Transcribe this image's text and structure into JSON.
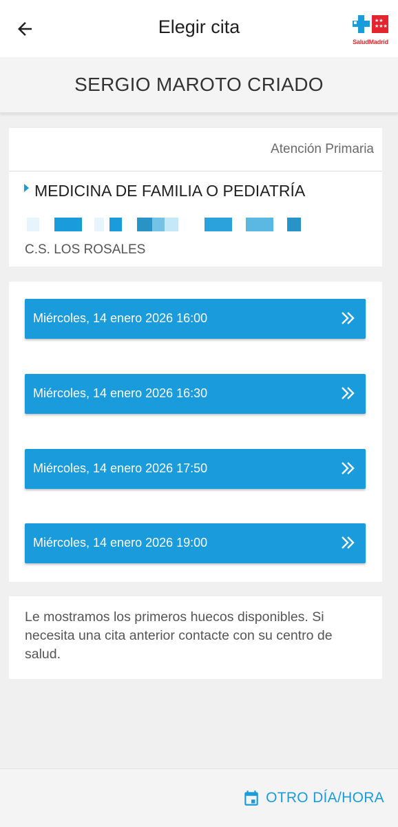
{
  "header": {
    "title": "Elegir cita",
    "back_icon": "arrow-back-icon",
    "logo_text": "SaludMadrid"
  },
  "patient": {
    "name": "SERGIO MAROTO CRIADO"
  },
  "info": {
    "care_level": "Atención Primaria",
    "specialty": "MEDICINA DE FAMILIA O PEDIATRÍA",
    "center": "C.S. LOS ROSALES"
  },
  "slots": [
    {
      "label": "Miércoles, 14 enero 2026 16:00"
    },
    {
      "label": "Miércoles, 14 enero 2026 16:30"
    },
    {
      "label": "Miércoles, 14 enero 2026 17:50"
    },
    {
      "label": "Miércoles, 14 enero 2026 19:00"
    }
  ],
  "note": "Le mostramos los primeros huecos disponibles. Si necesita una cita anterior contacte con su centro de salud.",
  "footer": {
    "other_label": "OTRO DÍA/HORA",
    "calendar_icon": "calendar-icon"
  },
  "colors": {
    "accent": "#1a9bdc",
    "brand_red": "#e3262d",
    "background": "#f0f0f0"
  }
}
